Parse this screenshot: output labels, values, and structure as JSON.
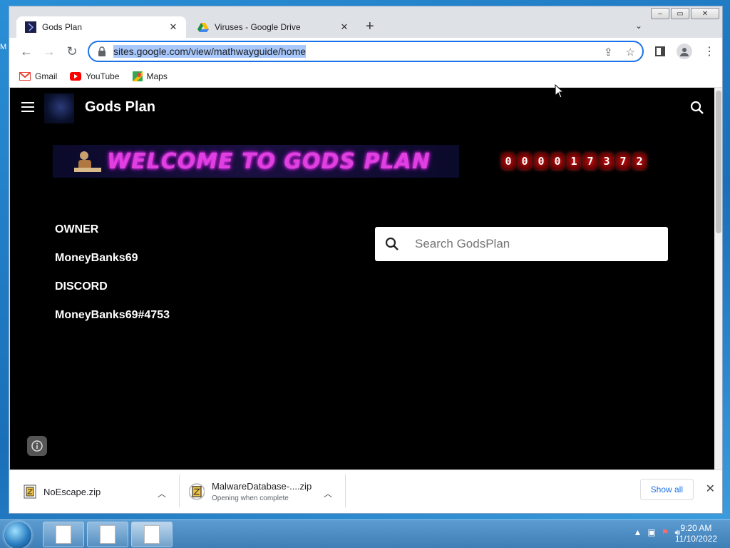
{
  "browser": {
    "tabs": [
      {
        "title": "Gods Plan",
        "active": true
      },
      {
        "title": "Viruses - Google Drive",
        "active": false
      }
    ],
    "url": "sites.google.com/view/mathwayguide/home",
    "bookmarks": [
      {
        "label": "Gmail",
        "icon": "gmail-icon"
      },
      {
        "label": "YouTube",
        "icon": "youtube-icon"
      },
      {
        "label": "Maps",
        "icon": "maps-icon"
      }
    ]
  },
  "site": {
    "title": "Gods Plan",
    "banner_text": "WELCOME TO GODS PLAN",
    "counter_digits": [
      "0",
      "0",
      "0",
      "0",
      "1",
      "7",
      "3",
      "7",
      "2"
    ],
    "info": [
      "OWNER",
      "MoneyBanks69",
      "DISCORD",
      "MoneyBanks69#4753"
    ],
    "search_placeholder": "Search GodsPlan"
  },
  "downloads": {
    "items": [
      {
        "name": "NoEscape.zip",
        "status": ""
      },
      {
        "name": "MalwareDatabase-....zip",
        "status": "Opening when complete"
      }
    ],
    "show_all": "Show all"
  },
  "taskbar": {
    "time": "9:20 AM",
    "date": "11/10/2022"
  },
  "desktop": {
    "edge_letter": "M"
  },
  "colors": {
    "accent": "#1a73e8",
    "page_bg": "#000000",
    "banner_text": "#e040e0",
    "counter_bg": "#c01010"
  }
}
